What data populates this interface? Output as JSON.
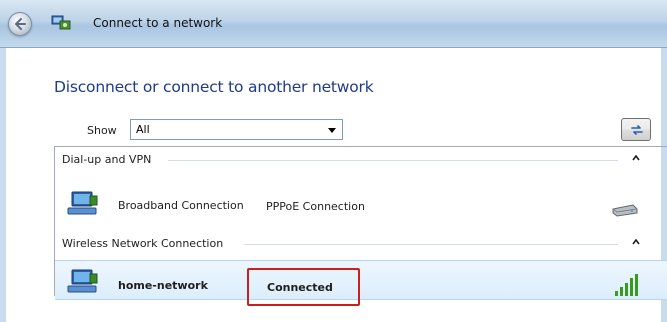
{
  "window": {
    "title": "Connect to a network"
  },
  "heading": "Disconnect or connect to another network",
  "filter": {
    "label": "Show",
    "selected": "All"
  },
  "groups": [
    {
      "label": "Dial-up and VPN",
      "items": [
        {
          "name": "Broadband Connection",
          "status": "PPPoE Connection",
          "icon": "network-computer-icon",
          "right_icon": "modem-icon"
        }
      ]
    },
    {
      "label": "Wireless Network Connection",
      "items": [
        {
          "name": "home-network",
          "status": "Connected",
          "icon": "network-computer-icon",
          "right_icon": "signal-strength-icon"
        }
      ]
    }
  ],
  "colors": {
    "heading": "#1f3b8c",
    "highlight_box": "#c8201f",
    "signal_bars": "#3a9a1f",
    "selected_row": "#dbeefc"
  }
}
